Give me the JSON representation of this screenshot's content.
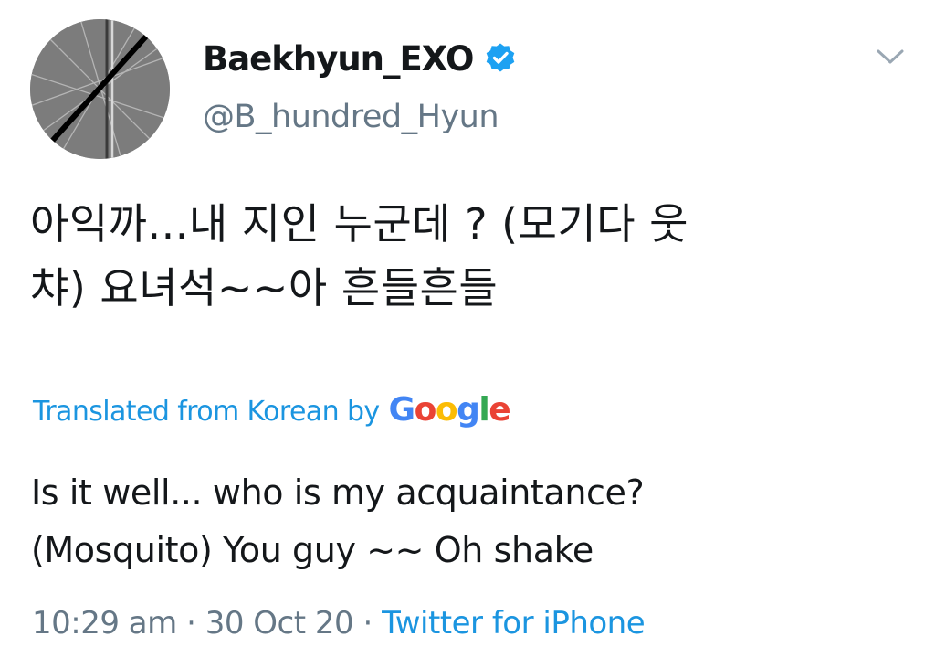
{
  "tweet": {
    "author": {
      "display_name": "Baekhyun_EXO",
      "handle": "@B_hundred_Hyun",
      "verified": true
    },
    "original_text": {
      "line1": "아익까...내 지인 누군데 ? (모기다 웃",
      "line2": "챠) 요녀석~~아 흔들흔들"
    },
    "translation": {
      "label": "Translated from Korean by",
      "provider_letters": [
        "G",
        "o",
        "o",
        "g",
        "l",
        "e"
      ],
      "line1": "Is it well... who is my acquaintance?",
      "line2": "(Mosquito) You guy ~~ Oh shake"
    },
    "meta": {
      "time": "10:29 am",
      "separator": "·",
      "date": "30 Oct 20",
      "source": "Twitter for iPhone"
    }
  },
  "icons": {
    "verified": "verified-badge-icon",
    "menu": "chevron-down-icon"
  },
  "colors": {
    "link_blue": "#1b95e0",
    "secondary_gray": "#657786",
    "text": "#14171a",
    "verified_blue": "#1da1f2"
  }
}
